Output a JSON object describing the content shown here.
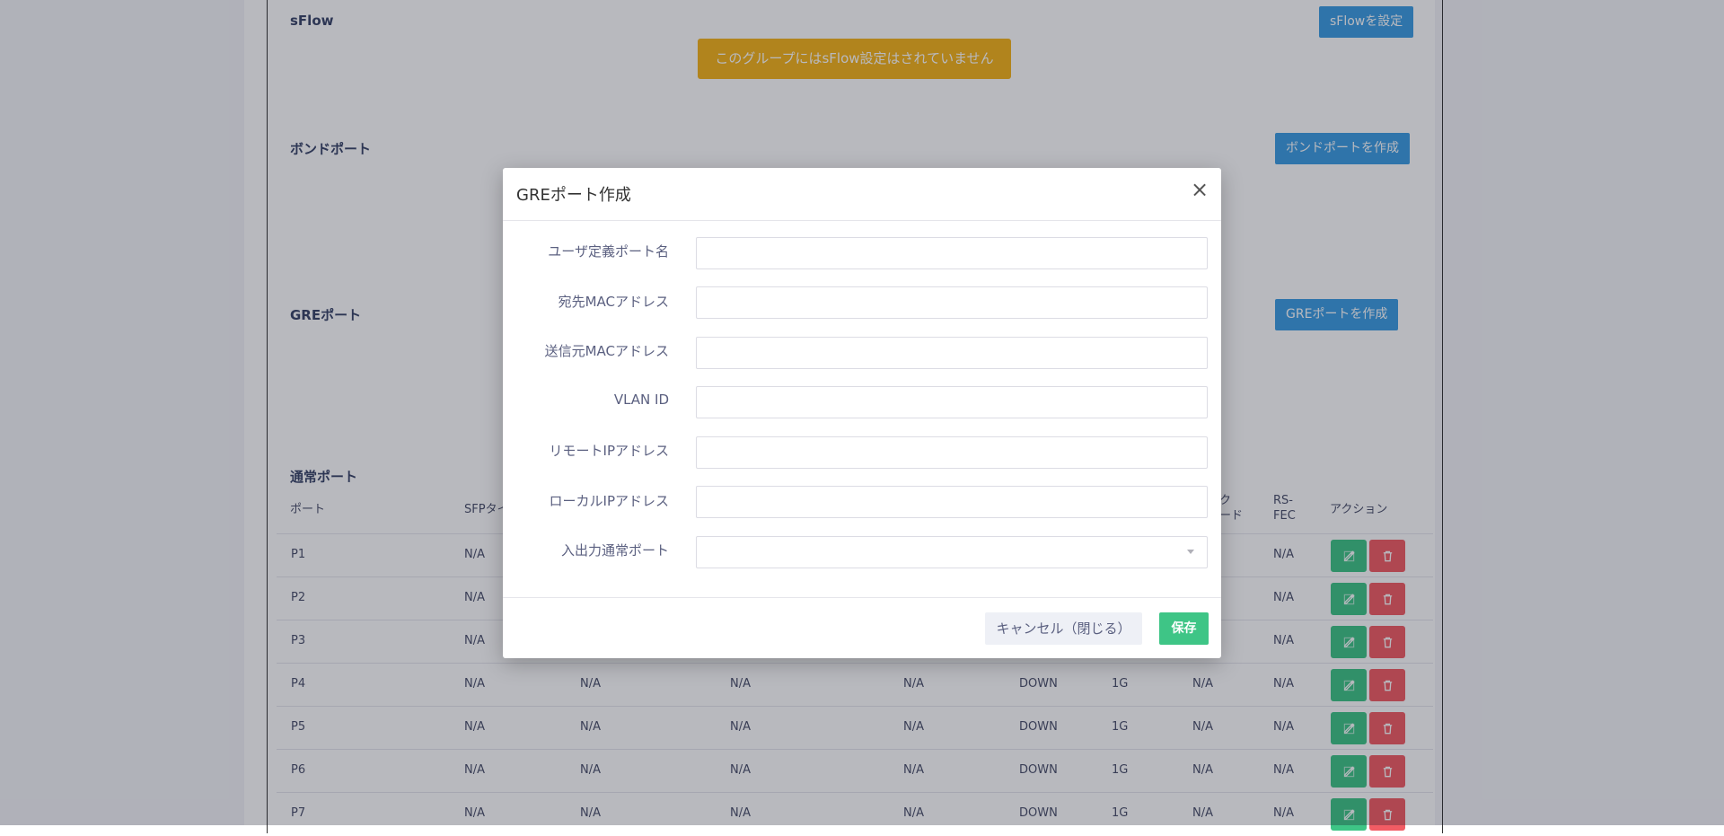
{
  "sflow": {
    "title": "sFlow",
    "button": "sFlowを設定",
    "alert": "このグループにはsFlow設定はされていません"
  },
  "bond": {
    "title": "ボンドポート",
    "button": "ボンドポートを作成"
  },
  "gre": {
    "title": "GREポート",
    "button": "GREポートを作成"
  },
  "normal_ports": {
    "title": "通常ポート",
    "headers": {
      "port": "ポート",
      "sfp": "SFPタイ",
      "link_mode": "ク\nード",
      "rsfec": "RS-\nFEC",
      "action": "アクション"
    },
    "rows": [
      {
        "port": "P1",
        "sfp": "N/A",
        "c3": "",
        "c4": "",
        "c5": "",
        "status": "",
        "speed": "",
        "c8": "",
        "fec": "N/A"
      },
      {
        "port": "P2",
        "sfp": "N/A",
        "c3": "",
        "c4": "",
        "c5": "",
        "status": "",
        "speed": "",
        "c8": "",
        "fec": "N/A"
      },
      {
        "port": "P3",
        "sfp": "N/A",
        "c3": "",
        "c4": "",
        "c5": "",
        "status": "",
        "speed": "",
        "c8": "",
        "fec": "N/A"
      },
      {
        "port": "P4",
        "sfp": "N/A",
        "c3": "N/A",
        "c4": "N/A",
        "c5": "N/A",
        "status": "DOWN",
        "speed": "1G",
        "c8": "N/A",
        "fec": "N/A"
      },
      {
        "port": "P5",
        "sfp": "N/A",
        "c3": "N/A",
        "c4": "N/A",
        "c5": "N/A",
        "status": "DOWN",
        "speed": "1G",
        "c8": "N/A",
        "fec": "N/A"
      },
      {
        "port": "P6",
        "sfp": "N/A",
        "c3": "N/A",
        "c4": "N/A",
        "c5": "N/A",
        "status": "DOWN",
        "speed": "1G",
        "c8": "N/A",
        "fec": "N/A"
      },
      {
        "port": "P7",
        "sfp": "N/A",
        "c3": "N/A",
        "c4": "N/A",
        "c5": "N/A",
        "status": "DOWN",
        "speed": "1G",
        "c8": "N/A",
        "fec": "N/A"
      }
    ]
  },
  "modal": {
    "title": "GREポート作成",
    "close_label": "×",
    "fields": {
      "port_name": {
        "label": "ユーザ定義ポート名",
        "value": ""
      },
      "dst_mac": {
        "label": "宛先MACアドレス",
        "value": ""
      },
      "src_mac": {
        "label": "送信元MACアドレス",
        "value": ""
      },
      "vlan_id": {
        "label": "VLAN ID",
        "value": ""
      },
      "remote_ip": {
        "label": "リモートIPアドレス",
        "value": ""
      },
      "local_ip": {
        "label": "ローカルIPアドレス",
        "value": ""
      },
      "io_port": {
        "label": "入出力通常ポート",
        "value": ""
      }
    },
    "cancel_label": "キャンセル（閉じる）",
    "save_label": "保存"
  },
  "colors": {
    "primary_blue": "#3c9de2",
    "warning": "#f5b319",
    "success_green": "#3ec586",
    "danger_red": "#f25c64"
  },
  "icons": {
    "edit": "edit-icon",
    "delete": "trash-icon",
    "close": "close-icon"
  }
}
